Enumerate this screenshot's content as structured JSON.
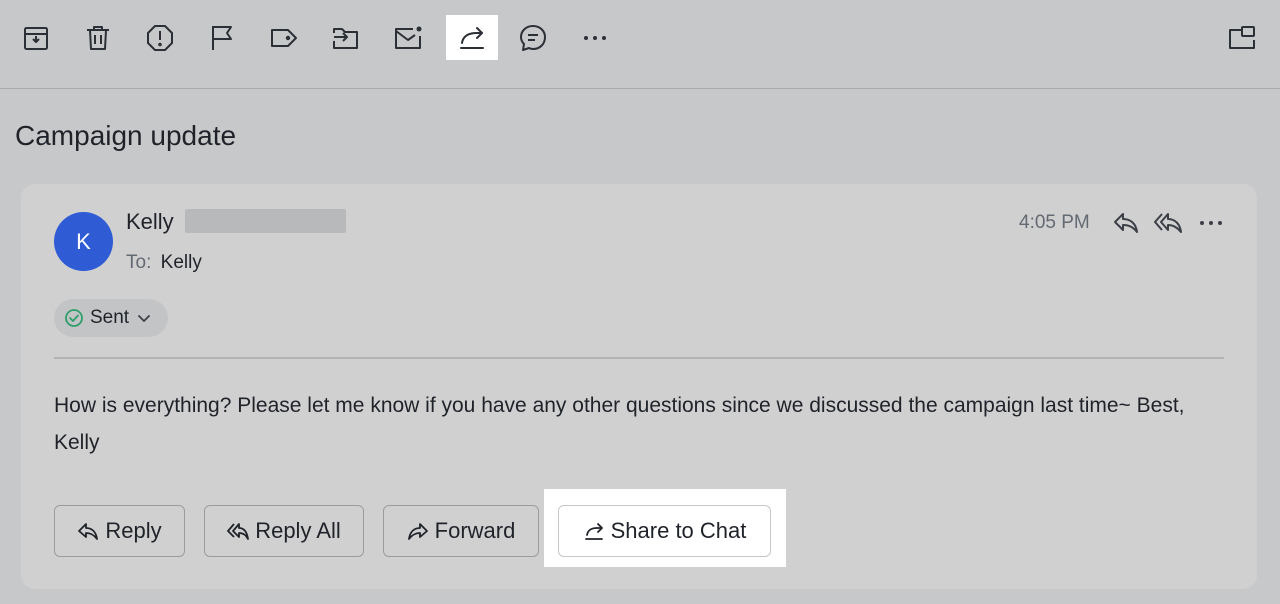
{
  "toolbar": {
    "icons": [
      {
        "name": "archive-icon"
      },
      {
        "name": "delete-icon"
      },
      {
        "name": "report-spam-icon"
      },
      {
        "name": "flag-icon"
      },
      {
        "name": "label-icon"
      },
      {
        "name": "move-to-icon"
      },
      {
        "name": "mark-unread-icon"
      },
      {
        "name": "share-icon",
        "highlighted": true
      },
      {
        "name": "comment-icon"
      },
      {
        "name": "more-icon"
      }
    ],
    "right_icon": "open-in-window-icon"
  },
  "subject": "Campaign update",
  "message": {
    "avatar_initial": "K",
    "avatar_color": "#2f5bd4",
    "sender_name": "Kelly",
    "to_label": "To:",
    "to_name": "Kelly",
    "time": "4:05 PM",
    "status": "Sent",
    "status_color": "#2e9e6a",
    "body": "How is everything? Please let me know if you have any other questions since we discussed the campaign last time~ Best, Kelly"
  },
  "actions": {
    "reply": "Reply",
    "reply_all": "Reply All",
    "forward": "Forward",
    "share_to_chat": "Share to Chat"
  }
}
